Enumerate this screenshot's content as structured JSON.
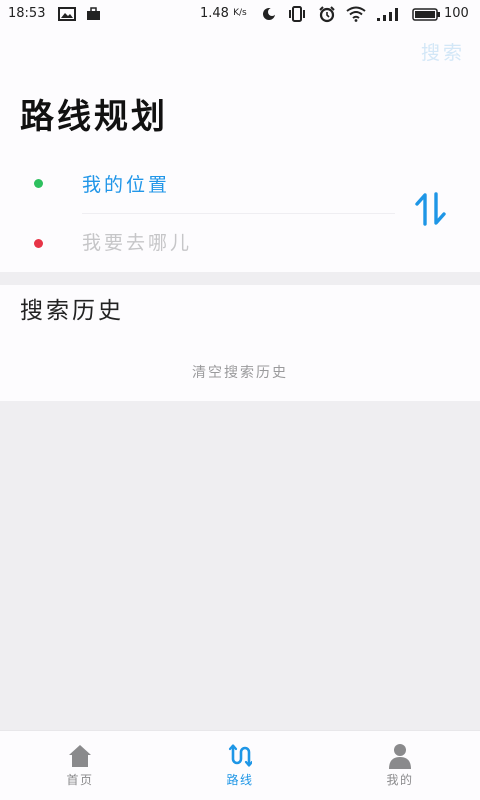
{
  "status_bar": {
    "time": "18:53",
    "net_speed": "1.48",
    "net_unit": "K/s",
    "battery": "100",
    "icons": [
      "image-icon",
      "briefcase-icon",
      "moon-icon",
      "vibrate-icon",
      "alarm-icon",
      "wifi-icon",
      "signal-icon",
      "battery-icon"
    ]
  },
  "header": {
    "search_label": "搜索",
    "title": "路线规划"
  },
  "route": {
    "origin": {
      "value": "我的位置",
      "dot_color": "#2ec05f"
    },
    "destination": {
      "placeholder": "我要去哪儿",
      "dot_color": "#e73447"
    },
    "swap_icon": "swap-vertical-icon"
  },
  "history": {
    "title": "搜索历史",
    "clear_label": "清空搜索历史"
  },
  "bottom_nav": {
    "items": [
      {
        "label": "首页",
        "icon": "home-icon",
        "active": false
      },
      {
        "label": "路线",
        "icon": "route-icon",
        "active": true
      },
      {
        "label": "我的",
        "icon": "person-icon",
        "active": false
      }
    ]
  },
  "colors": {
    "accent": "#1e96e6",
    "page_background": "#efeef1",
    "panel_background": "#fdfcfe"
  }
}
